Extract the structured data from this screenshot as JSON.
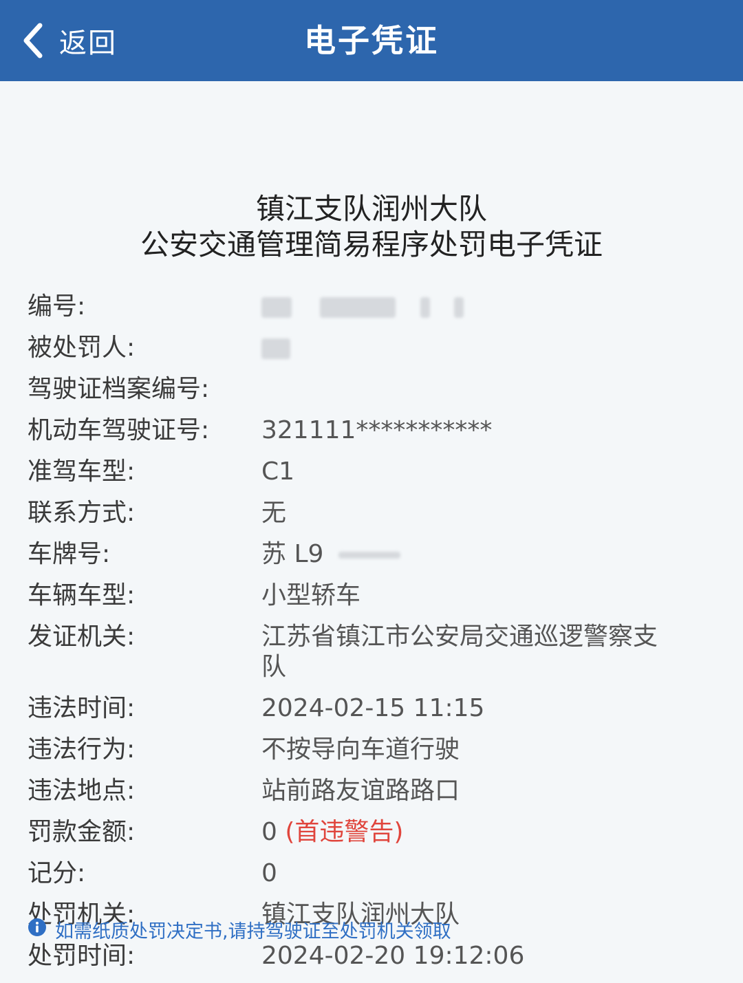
{
  "nav": {
    "back_label": "返回",
    "title": "电子凭证"
  },
  "document": {
    "title_line1": "镇江支队润州大队",
    "title_line2": "公安交通管理简易程序处罚电子凭证"
  },
  "fields": [
    {
      "label": "编号:",
      "value": ""
    },
    {
      "label": "被处罚人:",
      "value": ""
    },
    {
      "label": "驾驶证档案编号:",
      "value": ""
    },
    {
      "label": "机动车驾驶证号:",
      "value": "321111***********"
    },
    {
      "label": "准驾车型:",
      "value": "C1"
    },
    {
      "label": "联系方式:",
      "value": "无"
    },
    {
      "label": "车牌号:",
      "value": "苏 L9"
    },
    {
      "label": "车辆车型:",
      "value": "小型轿车"
    },
    {
      "label": "发证机关:",
      "value": "江苏省镇江市公安局交通巡逻警察支队"
    },
    {
      "label": "违法时间:",
      "value": "2024-02-15 11:15"
    },
    {
      "label": "违法行为:",
      "value": "不按导向车道行驶"
    },
    {
      "label": "违法地点:",
      "value": "站前路友谊路路口"
    },
    {
      "label": "罚款金额:",
      "value": "0",
      "note": "(首违警告)"
    },
    {
      "label": "记分:",
      "value": "0"
    },
    {
      "label": "处罚机关:",
      "value": "镇江支队润州大队"
    },
    {
      "label": "处罚时间:",
      "value": "2024-02-20 19:12:06"
    }
  ],
  "notice": {
    "icon": "info-icon",
    "text": "如需纸质处罚决定书,请持驾驶证至处罚机关领取"
  },
  "colors": {
    "navbar": "#2d66ad",
    "background": "#f4f7f9",
    "warning": "#e0453c",
    "notice": "#2f6fc4"
  }
}
